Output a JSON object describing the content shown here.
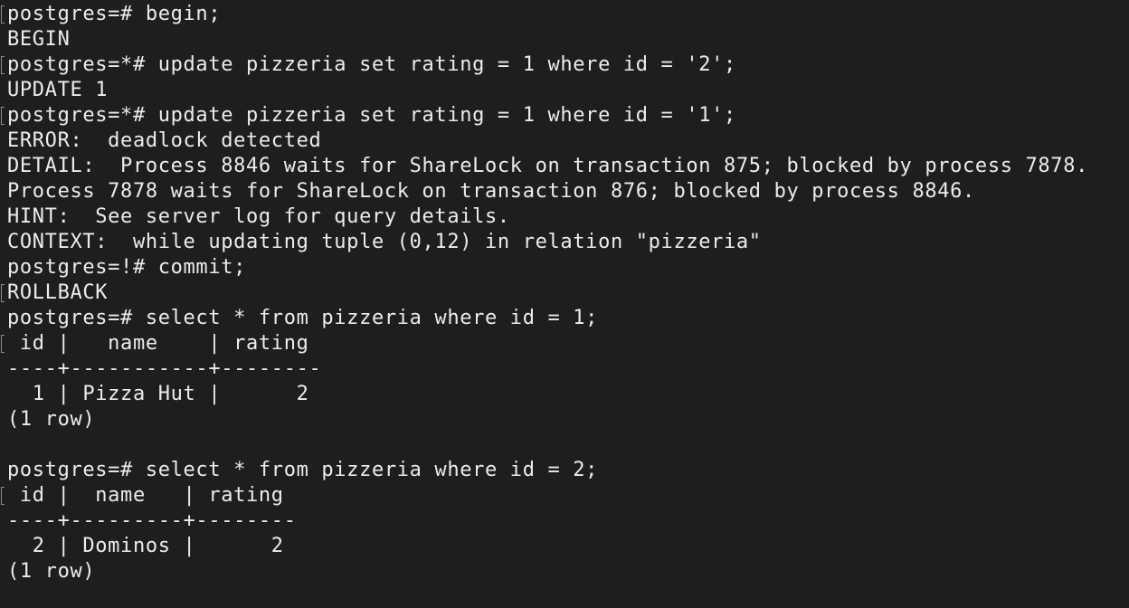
{
  "terminal": {
    "lines": [
      "postgres=# begin;",
      "BEGIN",
      "postgres=*# update pizzeria set rating = 1 where id = '2';",
      "UPDATE 1",
      "postgres=*# update pizzeria set rating = 1 where id = '1';",
      "ERROR:  deadlock detected",
      "DETAIL:  Process 8846 waits for ShareLock on transaction 875; blocked by process 7878.",
      "Process 7878 waits for ShareLock on transaction 876; blocked by process 8846.",
      "HINT:  See server log for query details.",
      "CONTEXT:  while updating tuple (0,12) in relation \"pizzeria\"",
      "postgres=!# commit;",
      "ROLLBACK",
      "postgres=# select * from pizzeria where id = 1;",
      " id |   name    | rating",
      "----+-----------+--------",
      "  1 | Pizza Hut |      2",
      "(1 row)",
      "",
      "postgres=# select * from pizzeria where id = 2;",
      " id |  name   | rating",
      "----+---------+--------",
      "  2 | Dominos |      2",
      "(1 row)"
    ]
  }
}
